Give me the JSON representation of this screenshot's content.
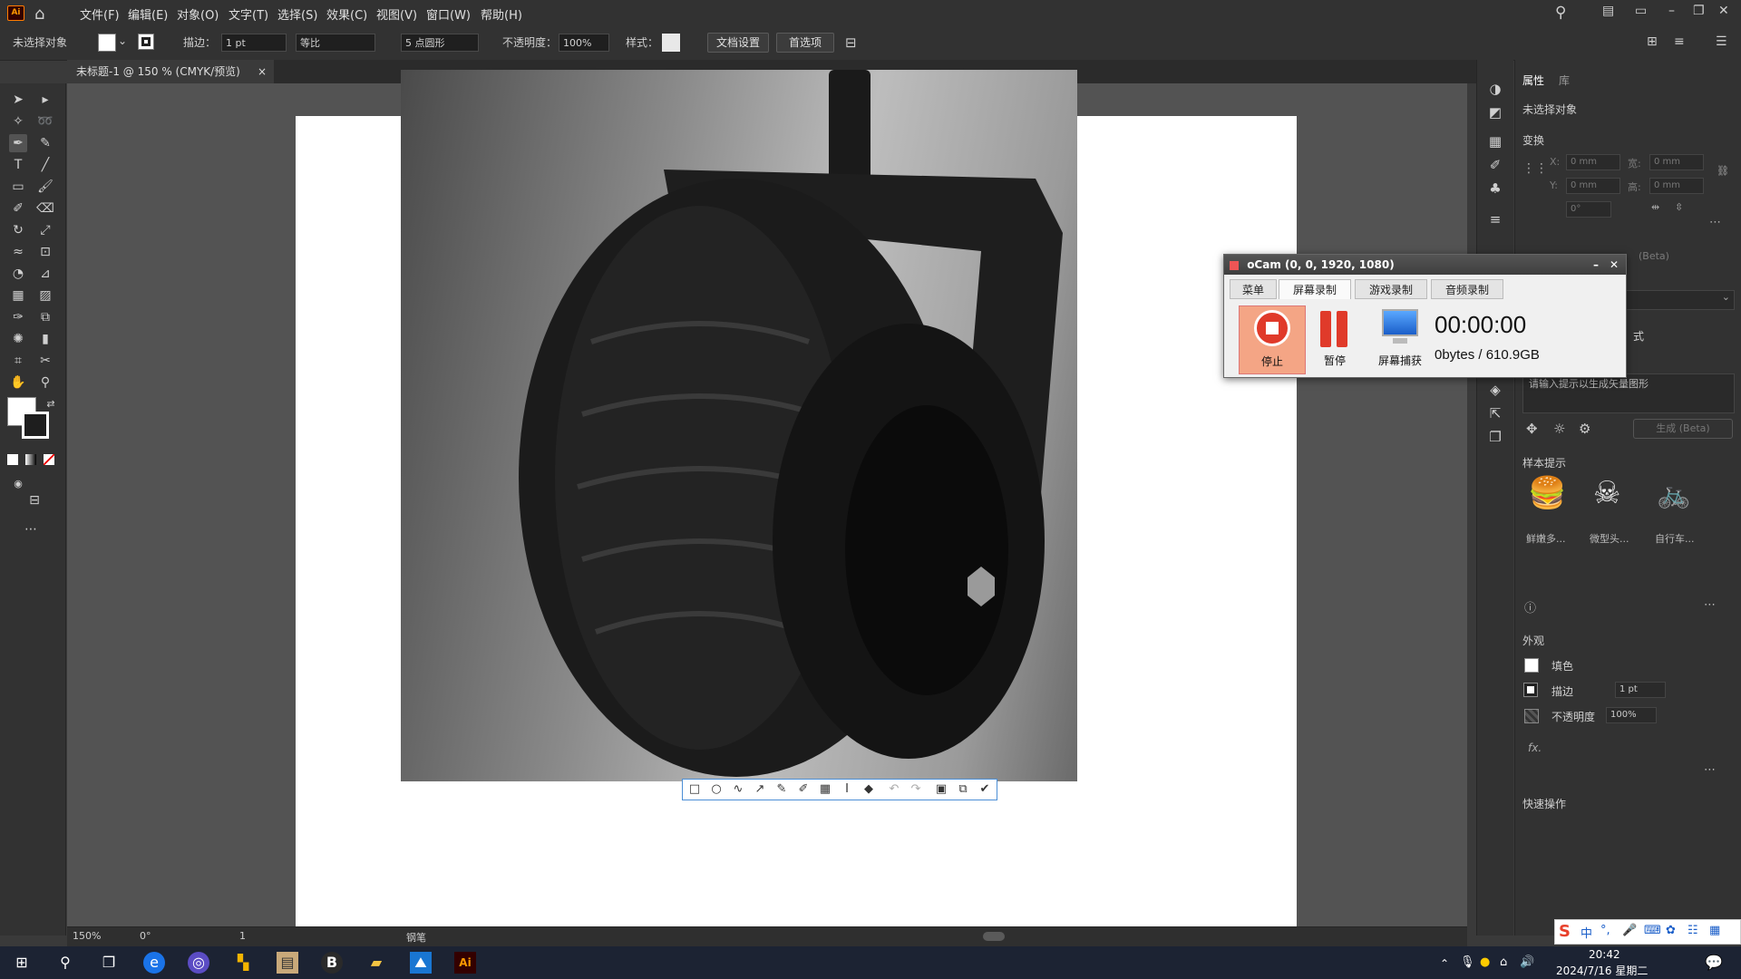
{
  "app": {
    "logo": "Ai",
    "home_icon": "home-icon"
  },
  "menu": [
    "文件(F)",
    "编辑(E)",
    "对象(O)",
    "文字(T)",
    "选择(S)",
    "效果(C)",
    "视图(V)",
    "窗口(W)",
    "帮助(H)"
  ],
  "control": {
    "selection": "未选择对象",
    "stroke_label": "描边：",
    "stroke_value": "1 pt",
    "profile": "等比",
    "brush": "5 点圆形",
    "opacity_label": "不透明度：",
    "opacity_value": "100%",
    "style_label": "样式：",
    "doc_setup": "文档设置",
    "prefs": "首选项"
  },
  "document": {
    "tab_title": "未标题-1 @ 150 % (CMYK/预览)",
    "close": "×"
  },
  "status": {
    "zoom": "150%",
    "rotation": "0°",
    "artboard": "1",
    "tool": "钢笔"
  },
  "panel": {
    "tabs": [
      "属性",
      "库"
    ],
    "selection": "未选择对象",
    "transform": "变换",
    "x_label": "X:",
    "y_label": "Y:",
    "w_label": "宽:",
    "h_label": "高:",
    "x_value": "0 mm",
    "y_value": "0 mm",
    "w_value": "0 mm",
    "h_value": "0 mm",
    "angle_value": "0°",
    "beta_fragment": "(Beta)",
    "style_fragment": "式",
    "prompt_fragment": "请输入提示以生成矢量图形",
    "generate_label": "生成 (Beta)",
    "samples_title": "样本提示",
    "samples": [
      {
        "label": "鲜嫩多...",
        "icon": "burger-icon"
      },
      {
        "label": "微型头...",
        "icon": "skull-icon"
      },
      {
        "label": "自行车...",
        "icon": "bicycle-icon"
      }
    ],
    "appearance_title": "外观",
    "fill_label": "填色",
    "stroke_label": "描边",
    "stroke_value": "1 pt",
    "opacity_label": "不透明度",
    "opacity_value": "100%",
    "fx": "fx.",
    "quick_actions": "快速操作"
  },
  "ocam": {
    "title": "oCam (0, 0, 1920, 1080)",
    "tabs": [
      "菜单",
      "屏幕录制",
      "游戏录制",
      "音频录制"
    ],
    "active_tab": "屏幕录制",
    "buttons": [
      "停止",
      "暂停",
      "屏幕捕获"
    ],
    "timer": "00:00:00",
    "size": "0bytes / 610.9GB"
  },
  "taskbar": {
    "time": "20:42",
    "date": "2024/7/16 星期二",
    "ime": "中"
  },
  "colors": {
    "accent": "#4c8fd6",
    "ocam_stop": "#e8573a",
    "ai_orange": "#ff9a00"
  }
}
